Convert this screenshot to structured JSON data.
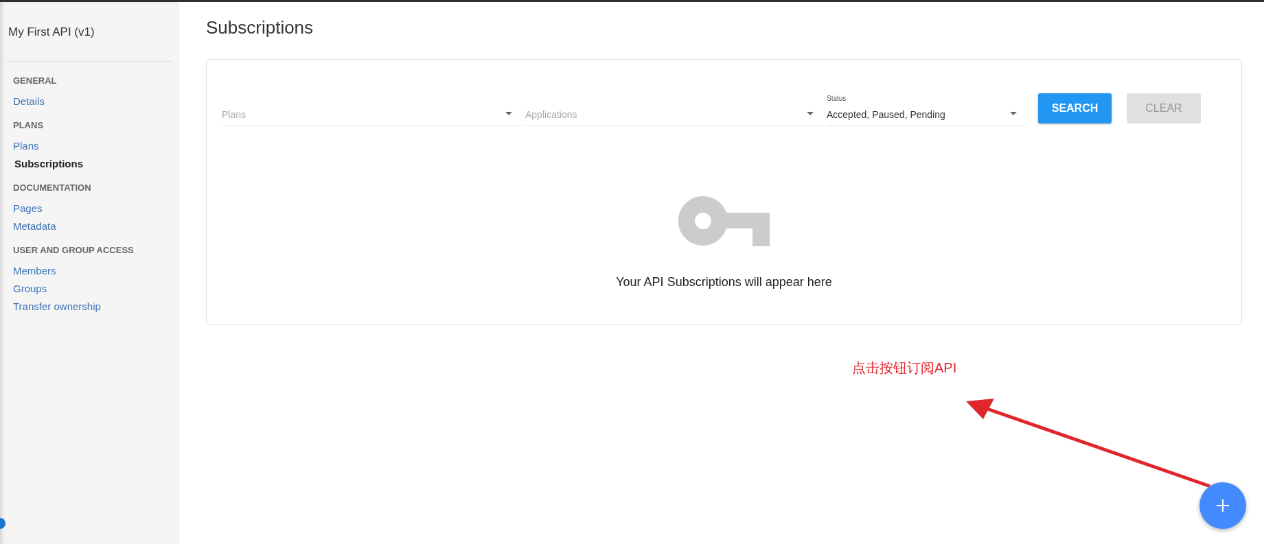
{
  "sidebar": {
    "title": "My First API (v1)",
    "sections": [
      {
        "heading": "GENERAL",
        "items": [
          {
            "label": "Details",
            "selected": false
          }
        ]
      },
      {
        "heading": "PLANS",
        "items": [
          {
            "label": "Plans",
            "selected": false
          },
          {
            "label": "Subscriptions",
            "selected": true
          }
        ]
      },
      {
        "heading": "DOCUMENTATION",
        "items": [
          {
            "label": "Pages",
            "selected": false
          },
          {
            "label": "Metadata",
            "selected": false
          }
        ]
      },
      {
        "heading": "USER AND GROUP ACCESS",
        "items": [
          {
            "label": "Members",
            "selected": false
          },
          {
            "label": "Groups",
            "selected": false
          },
          {
            "label": "Transfer ownership",
            "selected": false
          }
        ]
      }
    ]
  },
  "page_title": "Subscriptions",
  "filters": [
    {
      "kind": "select",
      "placeholder": "Plans"
    },
    {
      "kind": "select",
      "placeholder": "Applications"
    },
    {
      "kind": "select",
      "label": "Status",
      "value": "Accepted, Paused, Pending"
    }
  ],
  "buttons": [
    {
      "label": "SEARCH",
      "disabled": false
    },
    {
      "label": "CLEAR",
      "disabled": true
    }
  ],
  "empty_state": "Your API Subscriptions will appear here",
  "annotation": "点击按钮订阅API"
}
